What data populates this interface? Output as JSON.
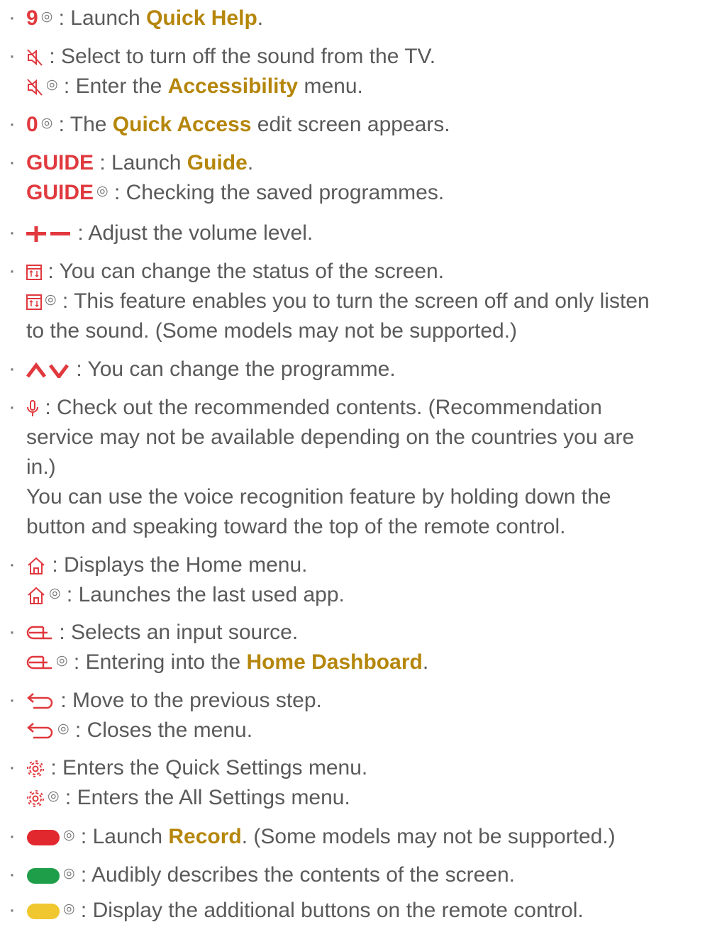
{
  "bullet": "·",
  "hold_symbol": "◎",
  "sep": " : ",
  "colors": {
    "key": "#e0393e",
    "link": "#b5860b",
    "text": "#5a5a5a",
    "record": "#e0282e",
    "green": "#1f9e4a",
    "yellow": "#f0c72e"
  },
  "items": {
    "nine": {
      "key": "9",
      "pre": "Launch ",
      "link": "Quick Help",
      "post": "."
    },
    "mute": {
      "icon": "mute-icon",
      "text": "Select to turn off the sound from the TV.",
      "hold_pre": "Enter the ",
      "hold_link": "Accessibility",
      "hold_post": " menu."
    },
    "zero": {
      "key": "0",
      "pre": "The ",
      "link": "Quick Access",
      "post": " edit screen appears."
    },
    "guide": {
      "key": "GUIDE",
      "pre": "Launch ",
      "link": "Guide",
      "post": ".",
      "hold_text": "Checking the saved programmes."
    },
    "volume": {
      "icon": "volume-icon",
      "text": "Adjust the volume level."
    },
    "screen": {
      "icon": "screen-mode-icon",
      "text": "You can change the status of the screen.",
      "hold_text": "This feature enables you to turn the screen off and only listen",
      "hold_text2": "to the sound. (Some models may not be supported.)"
    },
    "channel": {
      "icon": "channel-up-down-icon",
      "text": "You can change the programme."
    },
    "mic": {
      "icon": "microphone-icon",
      "text1": "Check out the recommended contents. (Recommendation",
      "text2": "service may not be available depending on the countries you are",
      "text3": "in.)",
      "text4": "You can use the voice recognition feature by holding down the",
      "text5": "button and speaking toward the top of the remote control."
    },
    "home": {
      "icon": "home-icon",
      "text": "Displays the Home menu.",
      "hold_text": "Launches the last used app."
    },
    "input": {
      "icon": "input-icon",
      "text": "Selects an input source.",
      "hold_pre": "Entering into the ",
      "hold_link": "Home Dashboard",
      "hold_post": "."
    },
    "back": {
      "icon": "back-icon",
      "text": "Move to the previous step.",
      "hold_text": "Closes the menu."
    },
    "settings": {
      "icon": "settings-icon",
      "text": "Enters the Quick Settings menu.",
      "hold_text": "Enters the All Settings menu."
    },
    "red": {
      "icon": "red-button-icon",
      "pre": "Launch ",
      "link": "Record",
      "post": ". (Some models may not be supported.)"
    },
    "green": {
      "icon": "green-button-icon",
      "text": "Audibly describes the contents of the screen."
    },
    "yellow": {
      "icon": "yellow-button-icon",
      "text": "Display the additional buttons on the remote control."
    }
  }
}
